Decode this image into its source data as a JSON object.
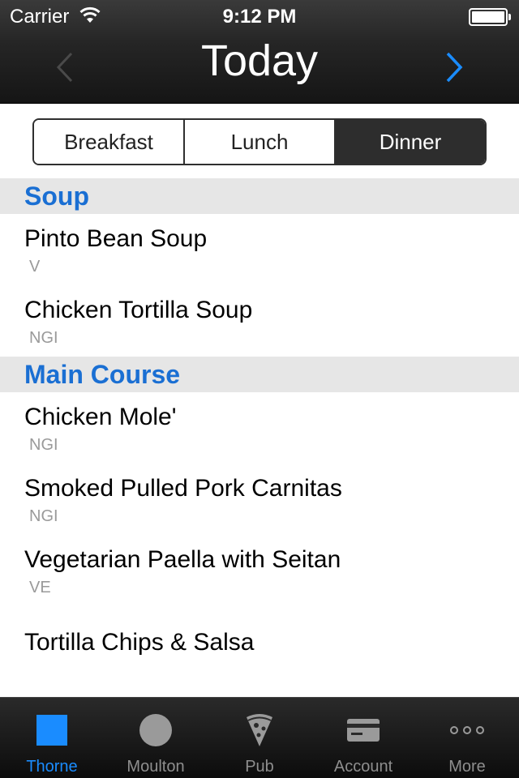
{
  "status_bar": {
    "carrier": "Carrier",
    "time": "9:12 PM"
  },
  "nav": {
    "title": "Today",
    "prev_icon": "chevron-left-icon",
    "next_icon": "chevron-right-icon",
    "accent": "#1a8cff"
  },
  "segments": [
    {
      "label": "Breakfast",
      "selected": false
    },
    {
      "label": "Lunch",
      "selected": false
    },
    {
      "label": "Dinner",
      "selected": true
    }
  ],
  "sections": [
    {
      "title": "Soup",
      "items": [
        {
          "name": "Pinto Bean Soup",
          "tag": "V"
        },
        {
          "name": "Chicken Tortilla Soup",
          "tag": "NGI"
        }
      ]
    },
    {
      "title": "Main Course",
      "items": [
        {
          "name": "Chicken Mole'",
          "tag": "NGI"
        },
        {
          "name": "Smoked Pulled Pork Carnitas",
          "tag": "NGI"
        },
        {
          "name": "Vegetarian Paella with Seitan",
          "tag": "VE"
        },
        {
          "name": "Tortilla Chips & Salsa",
          "tag": ""
        }
      ]
    }
  ],
  "tabs": [
    {
      "label": "Thorne",
      "icon": "square-icon",
      "selected": true
    },
    {
      "label": "Moulton",
      "icon": "circle-icon",
      "selected": false
    },
    {
      "label": "Pub",
      "icon": "pizza-icon",
      "selected": false
    },
    {
      "label": "Account",
      "icon": "card-icon",
      "selected": false
    },
    {
      "label": "More",
      "icon": "more-icon",
      "selected": false
    }
  ],
  "colors": {
    "section_title": "#1a6fd3",
    "tab_selected": "#1a8cff"
  }
}
